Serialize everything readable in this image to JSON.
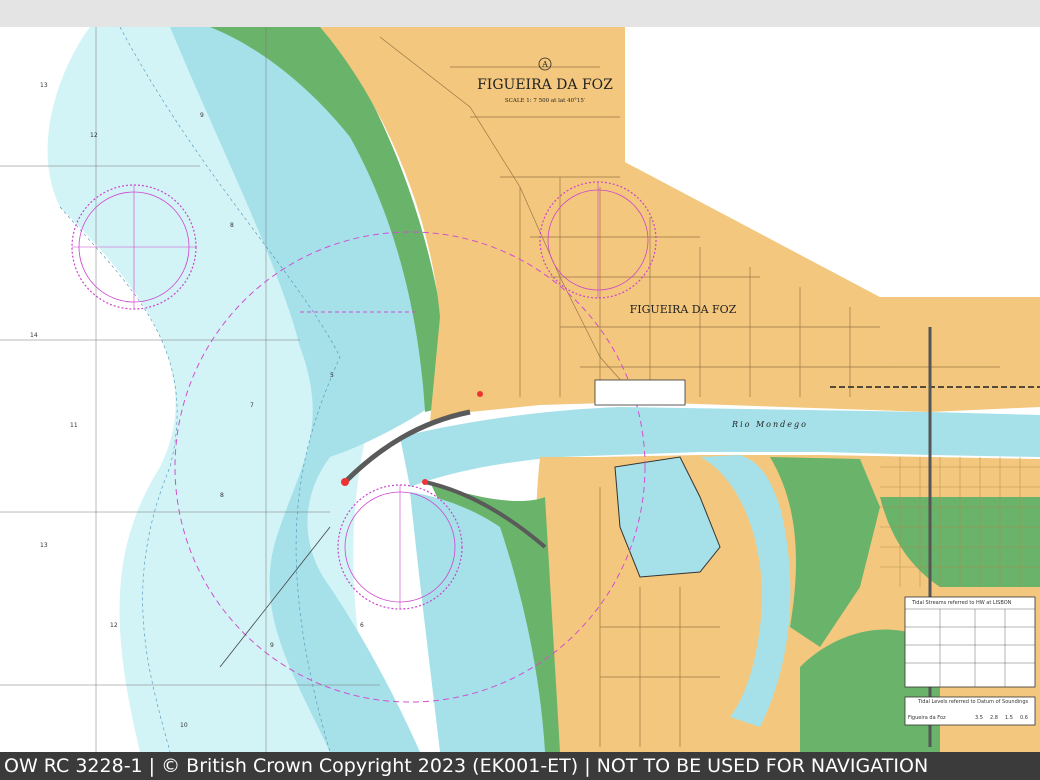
{
  "chart": {
    "panel_letter": "A",
    "title": "FIGUEIRA DA FOZ",
    "scale": "SCALE 1: 7 500 at lat 40°15′",
    "town_label": "FIGUEIRA DA FOZ",
    "river_label": "Rio Mondego",
    "tidal_streams_title": "Tidal Streams referred to HW at LISBON",
    "tidal_levels_title": "Tidal Levels referred to Datum of Soundings",
    "tidal_levels_place": "Figueira da Foz",
    "tidal_levels_values": [
      "3.5",
      "2.8",
      "1.5",
      "0.6"
    ]
  },
  "footer": {
    "text": "OW RC 3228-1 | © British Crown Copyright 2023 (EK001-ET) | NOT TO BE USED FOR NAVIGATION"
  }
}
